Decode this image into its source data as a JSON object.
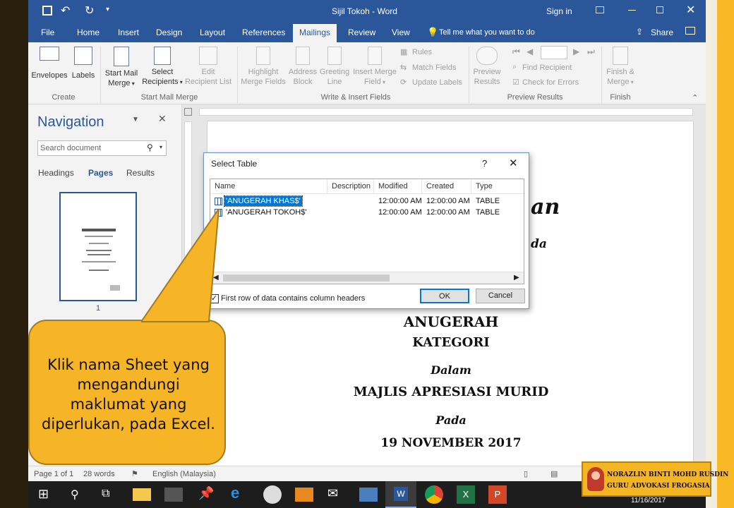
{
  "window": {
    "title": "Sijil Tokoh  -  Word",
    "signin": "Sign in"
  },
  "tabs": [
    "File",
    "Home",
    "Insert",
    "Design",
    "Layout",
    "References",
    "Mailings",
    "Review",
    "View"
  ],
  "tell_me": "Tell me what you want to do",
  "share": "Share",
  "ribbon": {
    "envelopes": "Envelopes",
    "labels": "Labels",
    "group_create": "Create",
    "start_mail_merge": "Start Mail",
    "merge": "Merge",
    "select": "Select",
    "recipients": "Recipients",
    "edit": "Edit",
    "recipient_list": "Recipient List",
    "group_start": "Start Mail Merge",
    "highlight": "Highlight",
    "merge_fields": "Merge Fields",
    "address": "Address",
    "block": "Block",
    "greeting": "Greeting",
    "line": "Line",
    "insert_merge": "Insert Merge",
    "field": "Field",
    "rules": "Rules",
    "match_fields": "Match Fields",
    "update_labels": "Update Labels",
    "group_write": "Write & Insert Fields",
    "preview": "Preview",
    "results": "Results",
    "find_recipient": "Find Recipient",
    "check_errors": "Check for Errors",
    "group_preview": "Preview Results",
    "finish": "Finish &",
    "finish_merge": "Merge",
    "group_finish": "Finish"
  },
  "navigation": {
    "title": "Navigation",
    "search_placeholder": "Search document",
    "tabs": [
      "Headings",
      "Pages",
      "Results"
    ],
    "page_number": "1"
  },
  "dialog": {
    "title": "Select Table",
    "help": "?",
    "columns": [
      "Name",
      "Description",
      "Modified",
      "Created",
      "Type"
    ],
    "rows": [
      {
        "name": "'ANUGERAH KHAS$'",
        "description": "",
        "modified": "12:00:00 AM",
        "created": "12:00:00 AM",
        "type": "TABLE"
      },
      {
        "name": "'ANUGERAH TOKOH$'",
        "description": "",
        "modified": "12:00:00 AM",
        "created": "12:00:00 AM",
        "type": "TABLE"
      }
    ],
    "checkbox_label": "First row of data contains column headers",
    "ok": "OK",
    "cancel": "Cancel"
  },
  "document": {
    "partial1": "an",
    "partial2": "da",
    "anugerah": "ANUGERAH",
    "kategori": "KATEGORI",
    "dalam": "Dalam",
    "majlis": "MAJLIS APRESIASI MURID",
    "pada": "Pada",
    "date": "19 NOVEMBER 2017"
  },
  "callout": "Klik nama Sheet yang mengandungi maklumat yang diperlukan, pada Excel.",
  "status": {
    "page": "Page 1 of 1",
    "words": "28 words",
    "language": "English (Malaysia)"
  },
  "taskbar": {
    "date": "11/16/2017"
  },
  "badge": {
    "line1": "NORAZLIN BINTI MOHD RUSDIN",
    "line2": "GURU ADVOKASI FROGASIA"
  },
  "colors": {
    "word_blue": "#2b579a",
    "callout": "#f5b526",
    "selection": "#0078d7"
  }
}
